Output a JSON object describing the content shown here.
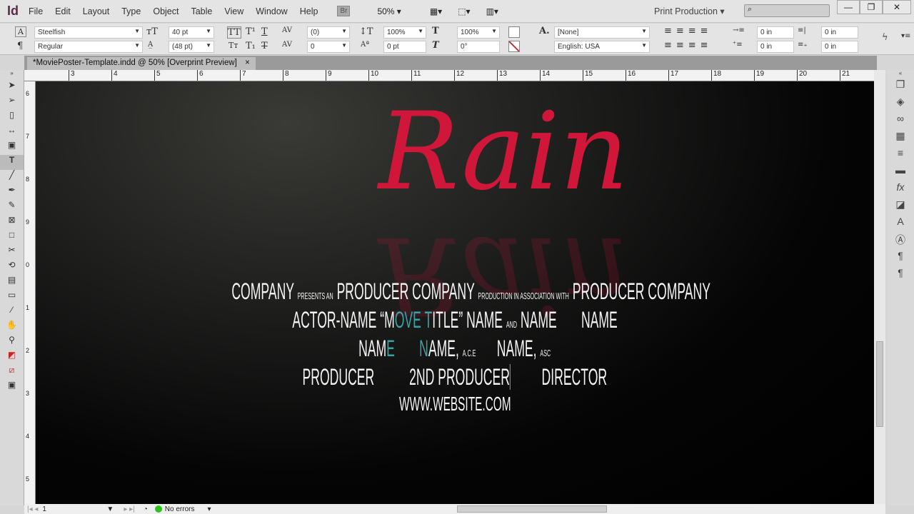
{
  "app": {
    "logo": "Id",
    "menus": [
      "File",
      "Edit",
      "Layout",
      "Type",
      "Object",
      "Table",
      "View",
      "Window",
      "Help"
    ],
    "bridge": "Br",
    "zoom": "50%",
    "workspace": "Print Production",
    "search_placeholder": "",
    "window_buttons": [
      "—",
      "❐",
      "✕"
    ]
  },
  "control": {
    "font_family": "Steelfish",
    "font_style": "Regular",
    "font_size": "40 pt",
    "leading": "(48 pt)",
    "kerning": "(0)",
    "tracking": "0",
    "vscale": "100%",
    "hscale": "100%",
    "baseline": "0 pt",
    "skew": "0°",
    "char_style": "[None]",
    "language": "English: USA",
    "left_indent": "0 in",
    "right_indent": "0 in",
    "first_indent": "0 in",
    "last_indent": "0 in"
  },
  "document": {
    "tab_title": "*MoviePoster-Template.indd @ 50% [Overprint Preview]",
    "close": "×"
  },
  "ruler": {
    "h": [
      "3",
      "4",
      "5",
      "6",
      "7",
      "8",
      "9",
      "10",
      "11",
      "12",
      "13",
      "14",
      "15",
      "16",
      "17",
      "18",
      "19",
      "20",
      "21"
    ],
    "v": [
      "6",
      "7",
      "8",
      "9",
      "0",
      "1",
      "2",
      "3",
      "4",
      "5"
    ]
  },
  "poster": {
    "title_logo": "Rain",
    "line1": {
      "a": "COMPANY",
      "b": "PRESENTS AN",
      "c": "PRODUCER COMPANY",
      "d": "PRODUCTION IN ASSOCIATION WITH",
      "e": "PRODUCER COMPANY"
    },
    "line2": {
      "a": "ACTOR-NAME “M",
      "b": "OVE T",
      "c": "ITLE” NAME",
      "d": "AND",
      "e": "NAME",
      "f": "NAME"
    },
    "line3": {
      "a": "NAM",
      "b": "E",
      "c": "N",
      "d": "AME,",
      "e": "A.C.E",
      "f": "NAME,",
      "g": "ASC"
    },
    "line4": {
      "a": "PRODUCER",
      "b": "2ND PRODUCER",
      "c": "DIRECTOR"
    },
    "line5": "WWW.WEBSITE.COM"
  },
  "status": {
    "page": "1",
    "errors": "No errors"
  },
  "colors": {
    "title_red": "#d0173a",
    "highlight": "#37a3a8"
  }
}
